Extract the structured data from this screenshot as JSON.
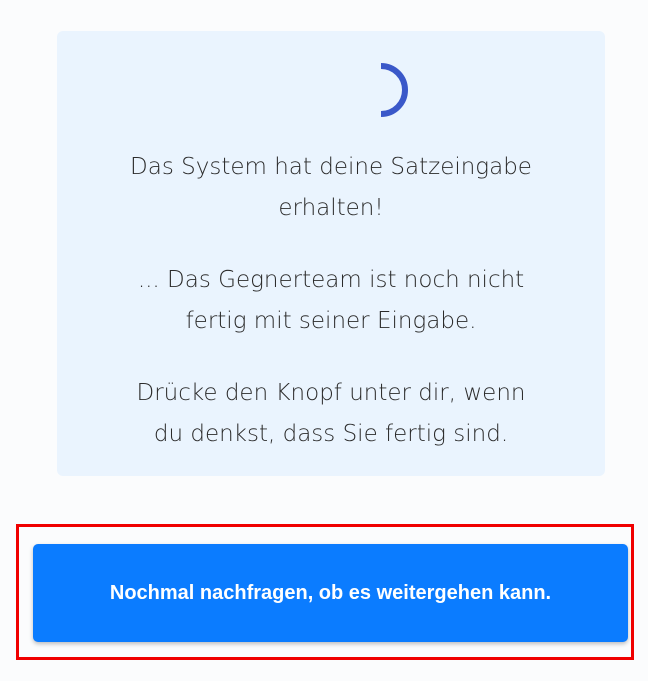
{
  "status": {
    "spinner_icon": "loading-spinner-icon",
    "accent_color": "#3a58c9",
    "line1": "Das System hat deine Satzeingabe\nerhalten!",
    "line2": "... Das Gegnerteam ist noch nicht\nfertig mit seiner Eingabe.",
    "line3": "Drücke den Knopf unter dir, wenn\ndu denkst, dass Sie fertig sind."
  },
  "action": {
    "button_label": "Nochmal nachfragen, ob es weitergehen kann.",
    "button_color": "#0b7cff",
    "highlight_color": "#f00000"
  }
}
